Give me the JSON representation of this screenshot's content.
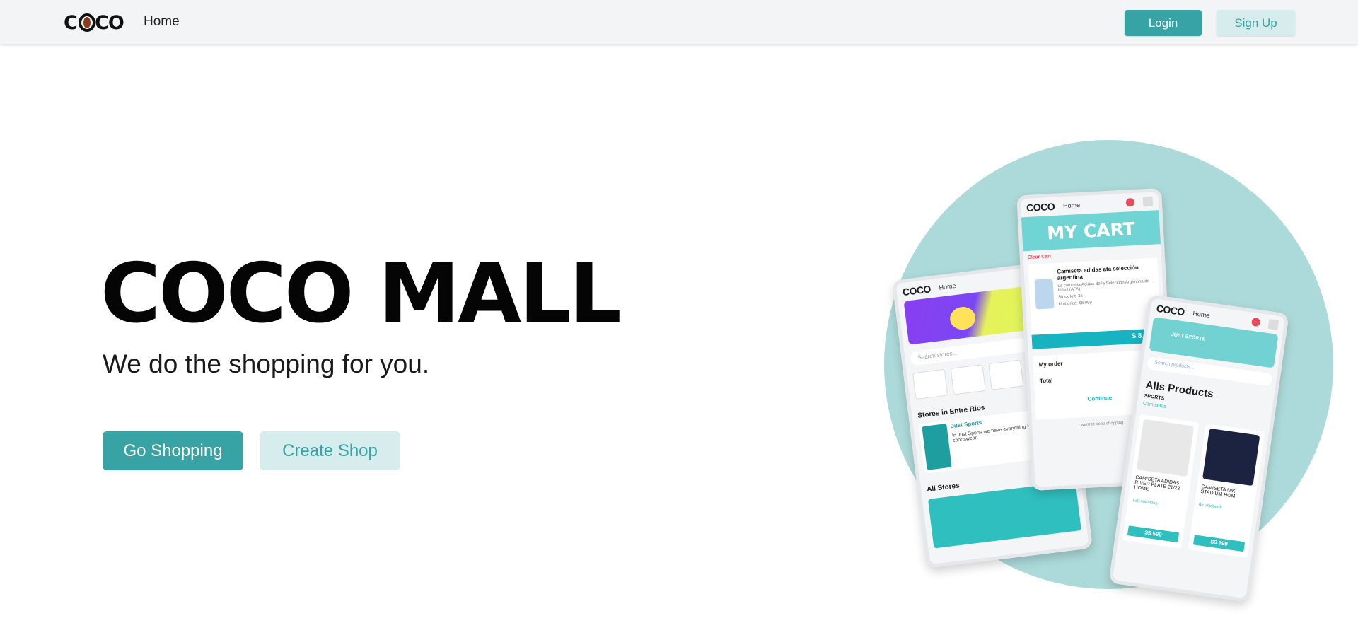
{
  "nav": {
    "logo_text": "COCO",
    "home": "Home",
    "login": "Login",
    "signup": "Sign Up"
  },
  "hero": {
    "title": "COCO MALL",
    "subtitle": "We do the shopping for you.",
    "go_shopping": "Go Shopping",
    "create_shop": "Create Shop"
  },
  "illustration": {
    "home_screen": {
      "logo": "COCO",
      "home": "Home",
      "search": "Search stores...",
      "stores_section": "Stores in Entre Rios",
      "store_name": "Just Sports",
      "store_desc": "In Just Sports we have everything in footwear a sportswear.",
      "all_stores": "All Stores"
    },
    "cart_screen": {
      "logo": "COCO",
      "home": "Home",
      "banner": "MY CART",
      "clear_cart": "Clear Cart",
      "item_title": "Camiseta adidas afa selección argentina",
      "item_desc": "La camiseta Adidas de la Selección Argentina de fútbol (AFA)",
      "item_stock": "Stock left: 35",
      "item_unit_price": "Unit price: $8.999",
      "item_price": "$ 8.999",
      "my_order": "My order",
      "total_label": "Total",
      "total_value": "$ 8",
      "continue": "Continue",
      "keep_shopping": "I want to keep shopping"
    },
    "products_screen": {
      "logo": "COCO",
      "home": "Home",
      "store_name": "JUST SPORTS",
      "search": "Search products...",
      "title": "Alls Products",
      "category": "SPORTS",
      "subcategory": "Camisetas",
      "products": [
        {
          "name": "CAMISETA ADIDAS RIVER PLATE 21/22 HOME",
          "units": "120 unidades",
          "price": "$5.599",
          "color": "#e8e8e8"
        },
        {
          "name": "CAMISETA NIK STADIUM HOM",
          "units": "86 unidades",
          "price": "$6.999",
          "color": "#1c2340"
        }
      ]
    },
    "colors": {
      "circle": "#acd9d9",
      "accent": "#38a3a5",
      "accent_light": "#d6eced"
    }
  }
}
